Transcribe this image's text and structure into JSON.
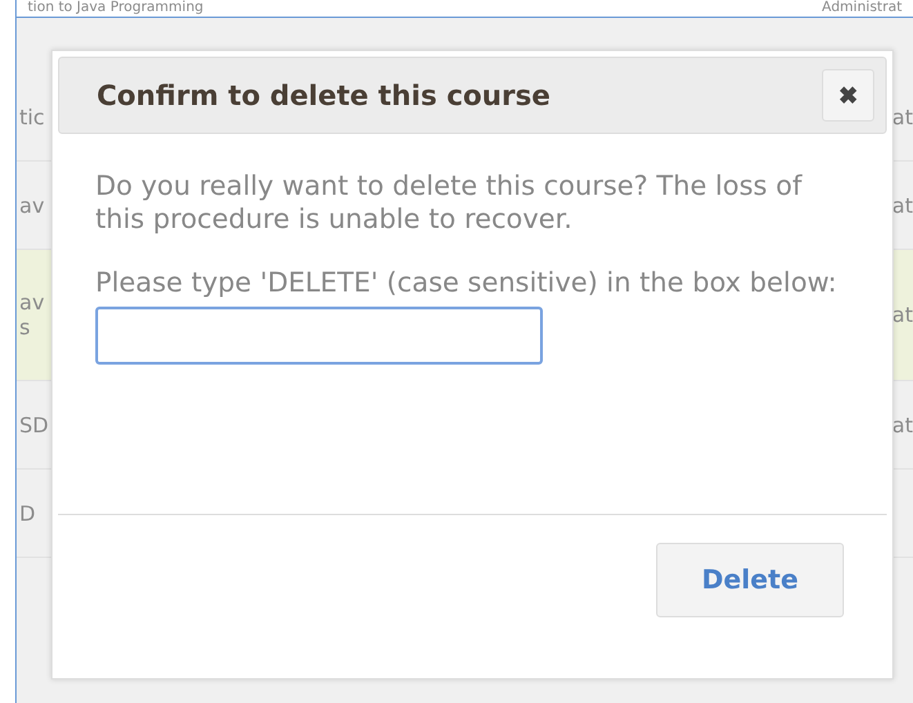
{
  "background_table": {
    "header": {
      "left": "tion to Java Programming",
      "right": "Administrat"
    },
    "rows": [
      {
        "left": "tic",
        "right": "at",
        "selected": false
      },
      {
        "left": "av",
        "right": "at",
        "selected": false
      },
      {
        "left": "av\ns",
        "right": "at",
        "selected": true
      },
      {
        "left": "SD",
        "right": "at",
        "selected": false
      },
      {
        "left": "D",
        "right": "",
        "selected": false
      }
    ]
  },
  "dialog": {
    "title": "Confirm to delete this course",
    "close": "✖",
    "message": "Do you really want to delete this course? The loss of this procedure is unable to recover.",
    "prompt": "Please type 'DELETE' (case sensitive) in the box below:",
    "buttons": [
      "Delete"
    ]
  }
}
